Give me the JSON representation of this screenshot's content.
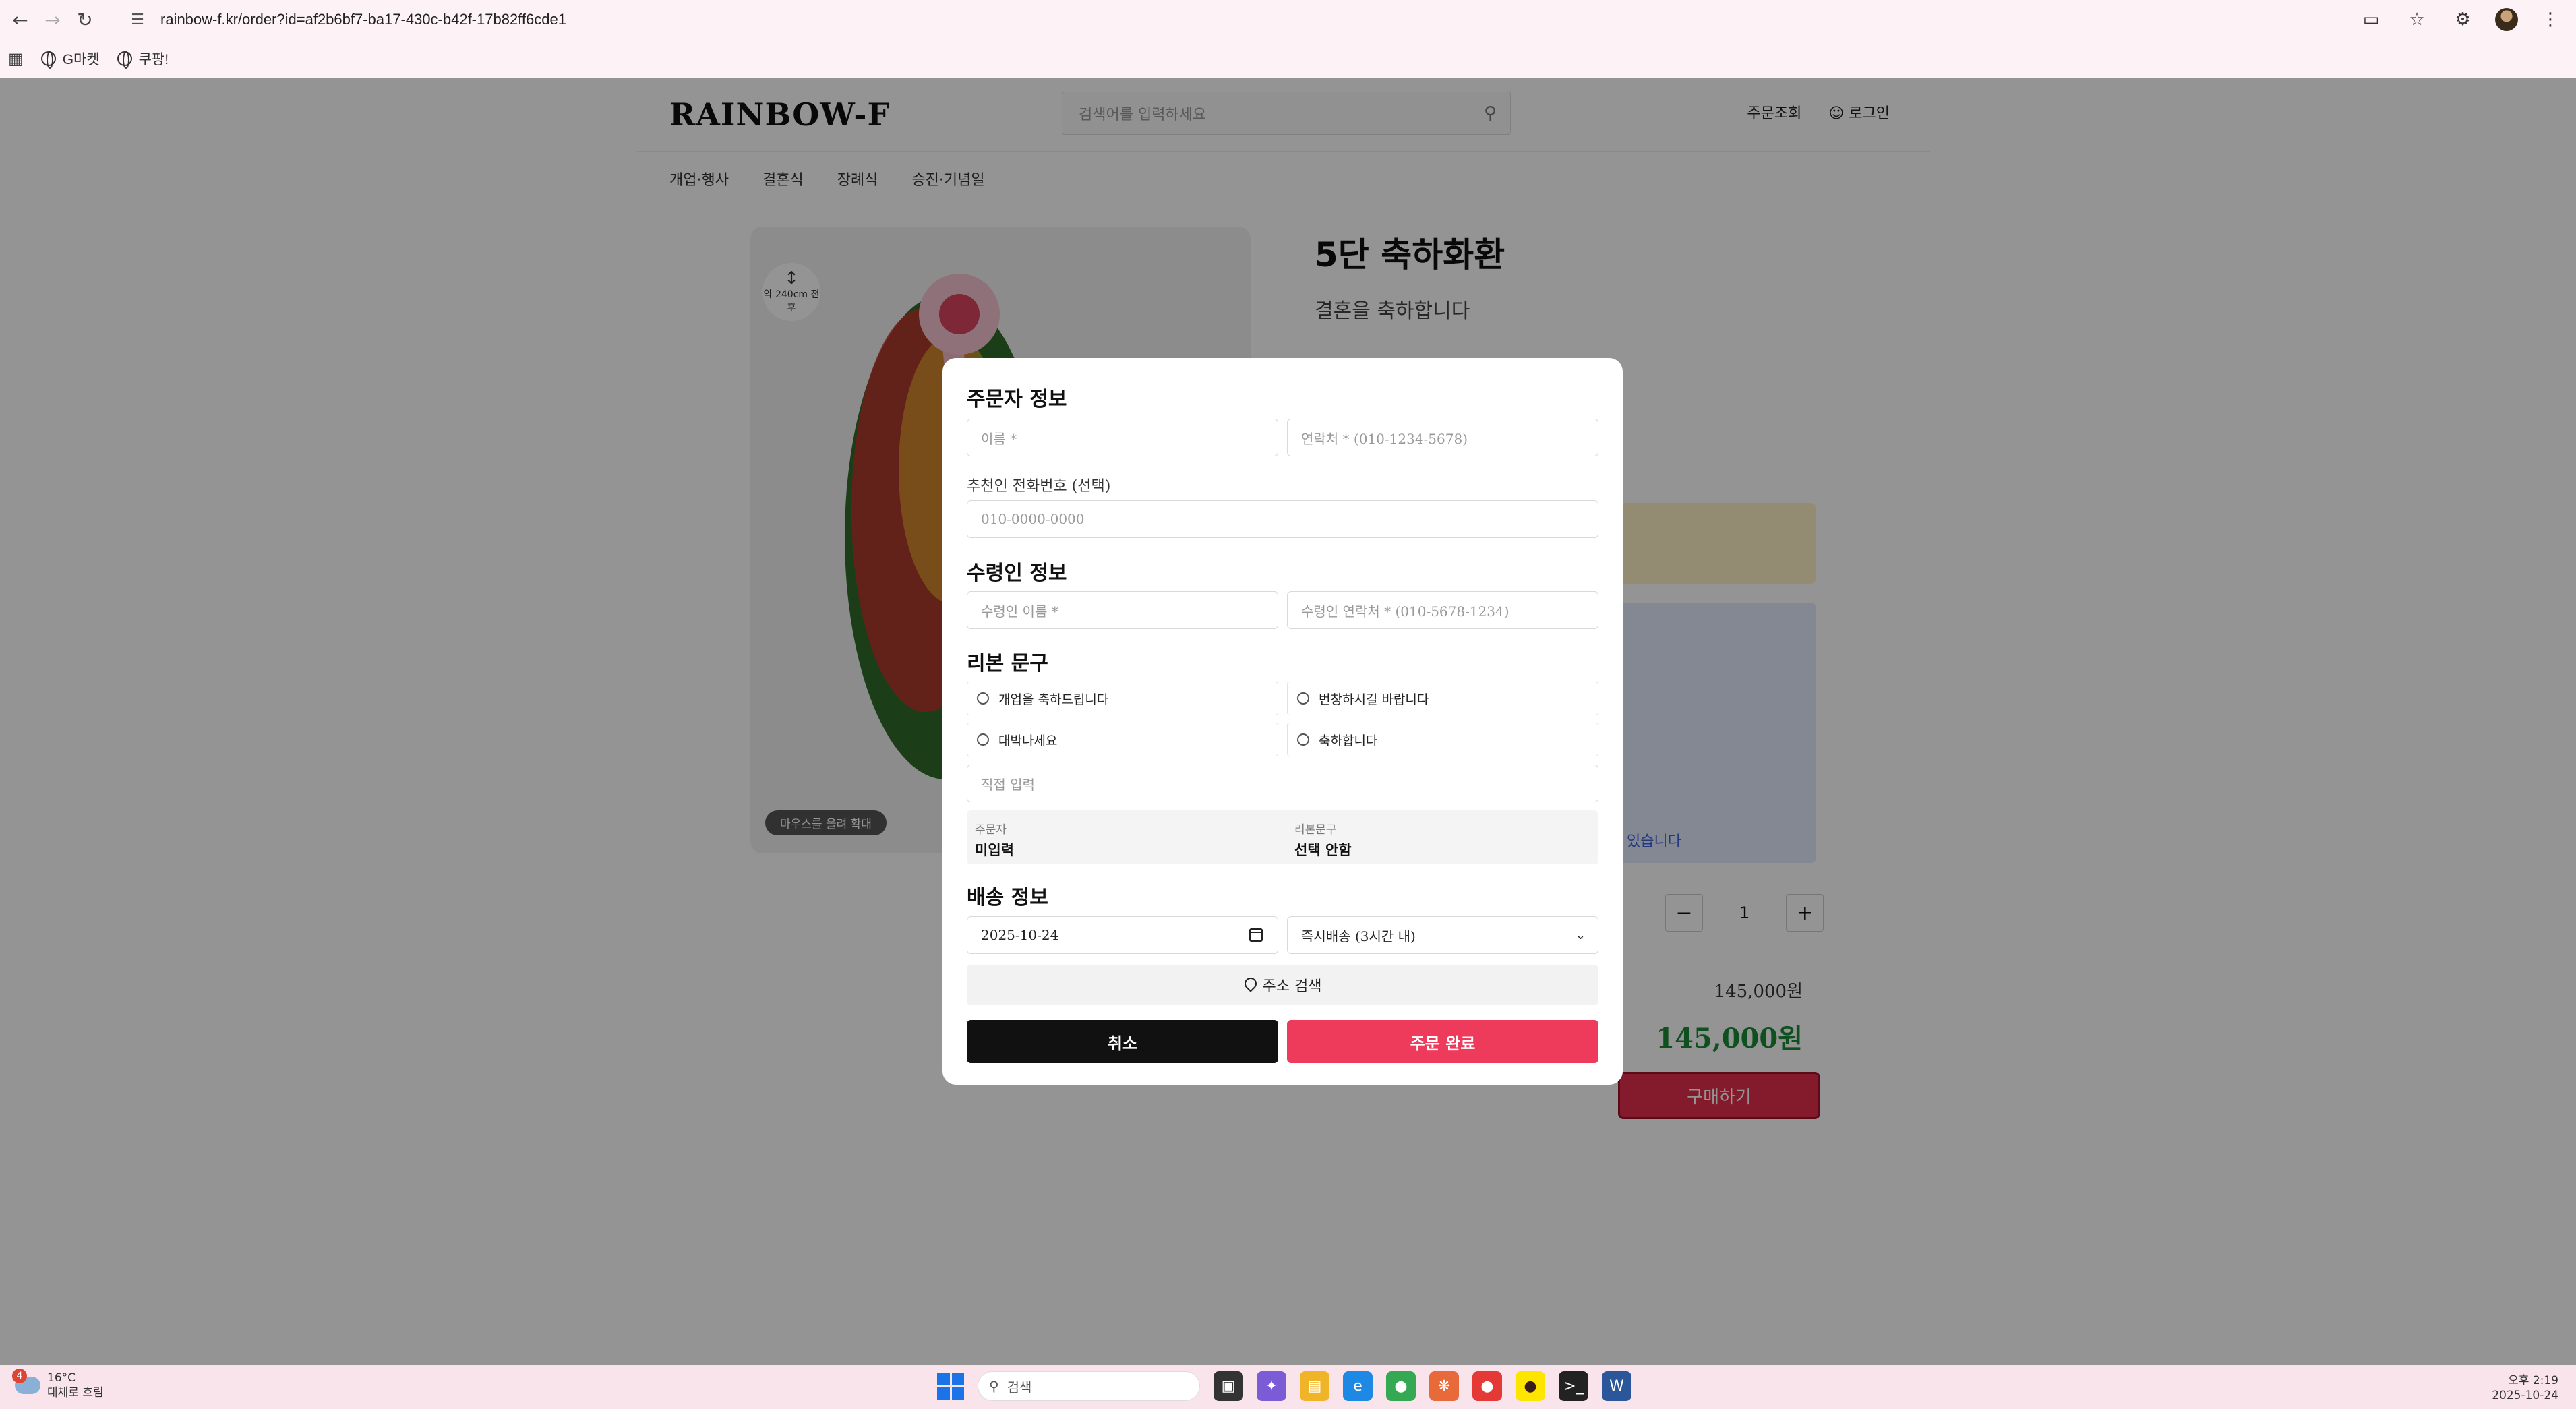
{
  "browser": {
    "url": "rainbow-f.kr/order?id=af2b6bf7-ba17-430c-b42f-17b82ff6cde1",
    "bookmarks": [
      "G마켓",
      "쿠팡!"
    ]
  },
  "site": {
    "logo": "RAINBOW-F",
    "search_placeholder": "검색어를 입력하세요",
    "order_lookup": "주문조회",
    "login": "로그인",
    "menu": [
      "개업·행사",
      "결혼식",
      "장례식",
      "승진·기념일"
    ],
    "size_badge": "약 240cm 전후",
    "hover_zoom": "마우스를 올려 확대",
    "product_title": "5단 축하화환",
    "product_subtitle": "결혼을 축하합니다",
    "price_fragment": "원",
    "blue_note": "수 있습니다",
    "quantity": "1",
    "price": "145,000원",
    "total": "145,000원",
    "buy_label": "구매하기"
  },
  "modal": {
    "orderer_title": "주문자 정보",
    "name_placeholder": "이름 *",
    "phone_placeholder": "연락처 * (010-1234-5678)",
    "referrer_label": "추천인 전화번호 (선택)",
    "referrer_placeholder": "010-0000-0000",
    "recipient_title": "수령인 정보",
    "recipient_name_placeholder": "수령인 이름 *",
    "recipient_phone_placeholder": "수령인 연락처 * (010-5678-1234)",
    "ribbon_title": "리본 문구",
    "ribbon_options": [
      "개업을 축하드립니다",
      "번창하시길 바랍니다",
      "대박나세요",
      "축하합니다"
    ],
    "custom_placeholder": "직접 입력",
    "summary": {
      "orderer_label": "주문자",
      "orderer_value": "미입력",
      "ribbon_label": "리본문구",
      "ribbon_value": "선택 안함"
    },
    "delivery_title": "배송 정보",
    "delivery_date": "2025-10-24",
    "delivery_option": "즉시배송 (3시간 내)",
    "address_search": "주소 검색",
    "cancel": "취소",
    "complete": "주문 완료"
  },
  "taskbar": {
    "weather_badge": "4",
    "temperature": "16°C",
    "weather_desc": "대체로 흐림",
    "search_label": "검색",
    "time": "오후 2:19",
    "date": "2025-10-24"
  }
}
